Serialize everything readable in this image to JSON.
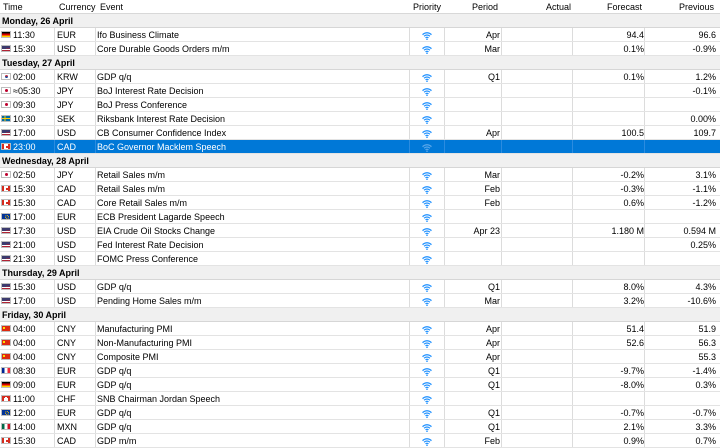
{
  "columns": {
    "time": "Time",
    "currency": "Currency",
    "event": "Event",
    "priority": "Priority",
    "period": "Period",
    "actual": "Actual",
    "forecast": "Forecast",
    "previous": "Previous"
  },
  "days": [
    {
      "label": "Monday, 26 April",
      "events": [
        {
          "flag": "de",
          "time": "11:30",
          "currency": "EUR",
          "event": "Ifo Business Climate",
          "period": "Apr",
          "actual": "",
          "forecast": "94.4",
          "previous": "96.6"
        },
        {
          "flag": "us",
          "time": "15:30",
          "currency": "USD",
          "event": "Core Durable Goods Orders m/m",
          "period": "Mar",
          "actual": "",
          "forecast": "0.1%",
          "previous": "-0.9%"
        }
      ]
    },
    {
      "label": "Tuesday, 27 April",
      "events": [
        {
          "flag": "kr",
          "time": "02:00",
          "currency": "KRW",
          "event": "GDP q/q",
          "period": "Q1",
          "actual": "",
          "forecast": "0.1%",
          "previous": "1.2%"
        },
        {
          "flag": "jp",
          "time": "≈05:30",
          "currency": "JPY",
          "event": "BoJ Interest Rate Decision",
          "period": "",
          "actual": "",
          "forecast": "",
          "previous": "-0.1%"
        },
        {
          "flag": "jp",
          "time": "09:30",
          "currency": "JPY",
          "event": "BoJ Press Conference",
          "period": "",
          "actual": "",
          "forecast": "",
          "previous": ""
        },
        {
          "flag": "se",
          "time": "10:30",
          "currency": "SEK",
          "event": "Riksbank Interest Rate Decision",
          "period": "",
          "actual": "",
          "forecast": "",
          "previous": "0.00%"
        },
        {
          "flag": "us",
          "time": "17:00",
          "currency": "USD",
          "event": "CB Consumer Confidence Index",
          "period": "Apr",
          "actual": "",
          "forecast": "100.5",
          "previous": "109.7"
        },
        {
          "flag": "ca",
          "time": "23:00",
          "currency": "CAD",
          "event": "BoC Governor Macklem Speech",
          "period": "",
          "actual": "",
          "forecast": "",
          "previous": "",
          "selected": true
        }
      ]
    },
    {
      "label": "Wednesday, 28 April",
      "events": [
        {
          "flag": "jp",
          "time": "02:50",
          "currency": "JPY",
          "event": "Retail Sales m/m",
          "period": "Mar",
          "actual": "",
          "forecast": "-0.2%",
          "previous": "3.1%"
        },
        {
          "flag": "ca",
          "time": "15:30",
          "currency": "CAD",
          "event": "Retail Sales m/m",
          "period": "Feb",
          "actual": "",
          "forecast": "-0.3%",
          "previous": "-1.1%"
        },
        {
          "flag": "ca",
          "time": "15:30",
          "currency": "CAD",
          "event": "Core Retail Sales m/m",
          "period": "Feb",
          "actual": "",
          "forecast": "0.6%",
          "previous": "-1.2%"
        },
        {
          "flag": "eu",
          "time": "17:00",
          "currency": "EUR",
          "event": "ECB President Lagarde Speech",
          "period": "",
          "actual": "",
          "forecast": "",
          "previous": ""
        },
        {
          "flag": "us",
          "time": "17:30",
          "currency": "USD",
          "event": "EIA Crude Oil Stocks Change",
          "period": "Apr 23",
          "actual": "",
          "forecast": "1.180 M",
          "previous": "0.594 M"
        },
        {
          "flag": "us",
          "time": "21:00",
          "currency": "USD",
          "event": "Fed Interest Rate Decision",
          "period": "",
          "actual": "",
          "forecast": "",
          "previous": "0.25%"
        },
        {
          "flag": "us",
          "time": "21:30",
          "currency": "USD",
          "event": "FOMC Press Conference",
          "period": "",
          "actual": "",
          "forecast": "",
          "previous": ""
        }
      ]
    },
    {
      "label": "Thursday, 29 April",
      "events": [
        {
          "flag": "us",
          "time": "15:30",
          "currency": "USD",
          "event": "GDP q/q",
          "period": "Q1",
          "actual": "",
          "forecast": "8.0%",
          "previous": "4.3%"
        },
        {
          "flag": "us",
          "time": "17:00",
          "currency": "USD",
          "event": "Pending Home Sales m/m",
          "period": "Mar",
          "actual": "",
          "forecast": "3.2%",
          "previous": "-10.6%"
        }
      ]
    },
    {
      "label": "Friday, 30 April",
      "events": [
        {
          "flag": "cn",
          "time": "04:00",
          "currency": "CNY",
          "event": "Manufacturing PMI",
          "period": "Apr",
          "actual": "",
          "forecast": "51.4",
          "previous": "51.9"
        },
        {
          "flag": "cn",
          "time": "04:00",
          "currency": "CNY",
          "event": "Non-Manufacturing PMI",
          "period": "Apr",
          "actual": "",
          "forecast": "52.6",
          "previous": "56.3"
        },
        {
          "flag": "cn",
          "time": "04:00",
          "currency": "CNY",
          "event": "Composite PMI",
          "period": "Apr",
          "actual": "",
          "forecast": "",
          "previous": "55.3"
        },
        {
          "flag": "fr",
          "time": "08:30",
          "currency": "EUR",
          "event": "GDP q/q",
          "period": "Q1",
          "actual": "",
          "forecast": "-9.7%",
          "previous": "-1.4%"
        },
        {
          "flag": "de",
          "time": "09:00",
          "currency": "EUR",
          "event": "GDP q/q",
          "period": "Q1",
          "actual": "",
          "forecast": "-8.0%",
          "previous": "0.3%"
        },
        {
          "flag": "ch",
          "time": "11:00",
          "currency": "CHF",
          "event": "SNB Chairman Jordan Speech",
          "period": "",
          "actual": "",
          "forecast": "",
          "previous": ""
        },
        {
          "flag": "eu",
          "time": "12:00",
          "currency": "EUR",
          "event": "GDP q/q",
          "period": "Q1",
          "actual": "",
          "forecast": "-0.7%",
          "previous": "-0.7%"
        },
        {
          "flag": "mx",
          "time": "14:00",
          "currency": "MXN",
          "event": "GDP q/q",
          "period": "Q1",
          "actual": "",
          "forecast": "2.1%",
          "previous": "3.3%"
        },
        {
          "flag": "ca",
          "time": "15:30",
          "currency": "CAD",
          "event": "GDP m/m",
          "period": "Feb",
          "actual": "",
          "forecast": "0.9%",
          "previous": "0.7%"
        }
      ]
    }
  ],
  "priority_icon": "wifi-signal-icon",
  "colors": {
    "selection": "#0078d7",
    "priority_icon": "#1e90ff",
    "day_header_bg": "#f0f0f0"
  }
}
